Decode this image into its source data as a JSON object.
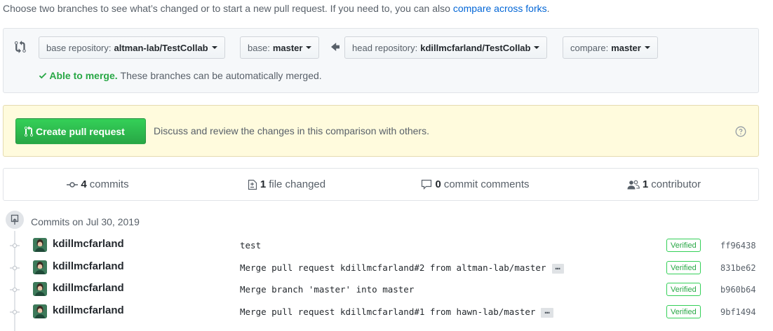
{
  "intro": {
    "text": "Choose two branches to see what’s changed or to start a new pull request. If you need to, you can also ",
    "link": "compare across forks",
    "end": "."
  },
  "range": {
    "icon": "compare-arrows-icon",
    "base_repo": {
      "label": "base repository:",
      "value": "altman-lab/TestCollab"
    },
    "base": {
      "label": "base:",
      "value": "master"
    },
    "head_repo": {
      "label": "head repository:",
      "value": "kdillmcfarland/TestCollab"
    },
    "compare": {
      "label": "compare:",
      "value": "master"
    },
    "merge_ok": "Able to merge.",
    "merge_desc": "These branches can be automatically merged."
  },
  "pr": {
    "button": "Create pull request",
    "description": "Discuss and review the changes in this comparison with others.",
    "accent": "#28a745"
  },
  "summary": {
    "commits": {
      "count": "4",
      "label": "commits"
    },
    "files": {
      "count": "1",
      "label": "file changed"
    },
    "comments": {
      "count": "0",
      "label": "commit comments"
    },
    "contributors": {
      "count": "1",
      "label": "contributor"
    }
  },
  "commits_date": "Commits on Jul 30, 2019",
  "commits": [
    {
      "author": "kdillmcfarland",
      "message": "test",
      "has_more": false,
      "verified": "Verified",
      "sha": "ff96438"
    },
    {
      "author": "kdillmcfarland",
      "message": "Merge pull request kdillmcfarland#2 from altman-lab/master",
      "has_more": true,
      "verified": "Verified",
      "sha": "831be62"
    },
    {
      "author": "kdillmcfarland",
      "message": "Merge branch 'master' into master",
      "has_more": false,
      "verified": "Verified",
      "sha": "b960b64"
    },
    {
      "author": "kdillmcfarland",
      "message": "Merge pull request kdillmcfarland#1 from hawn-lab/master",
      "has_more": true,
      "verified": "Verified",
      "sha": "9bf1494"
    }
  ],
  "ellipsis": "…"
}
